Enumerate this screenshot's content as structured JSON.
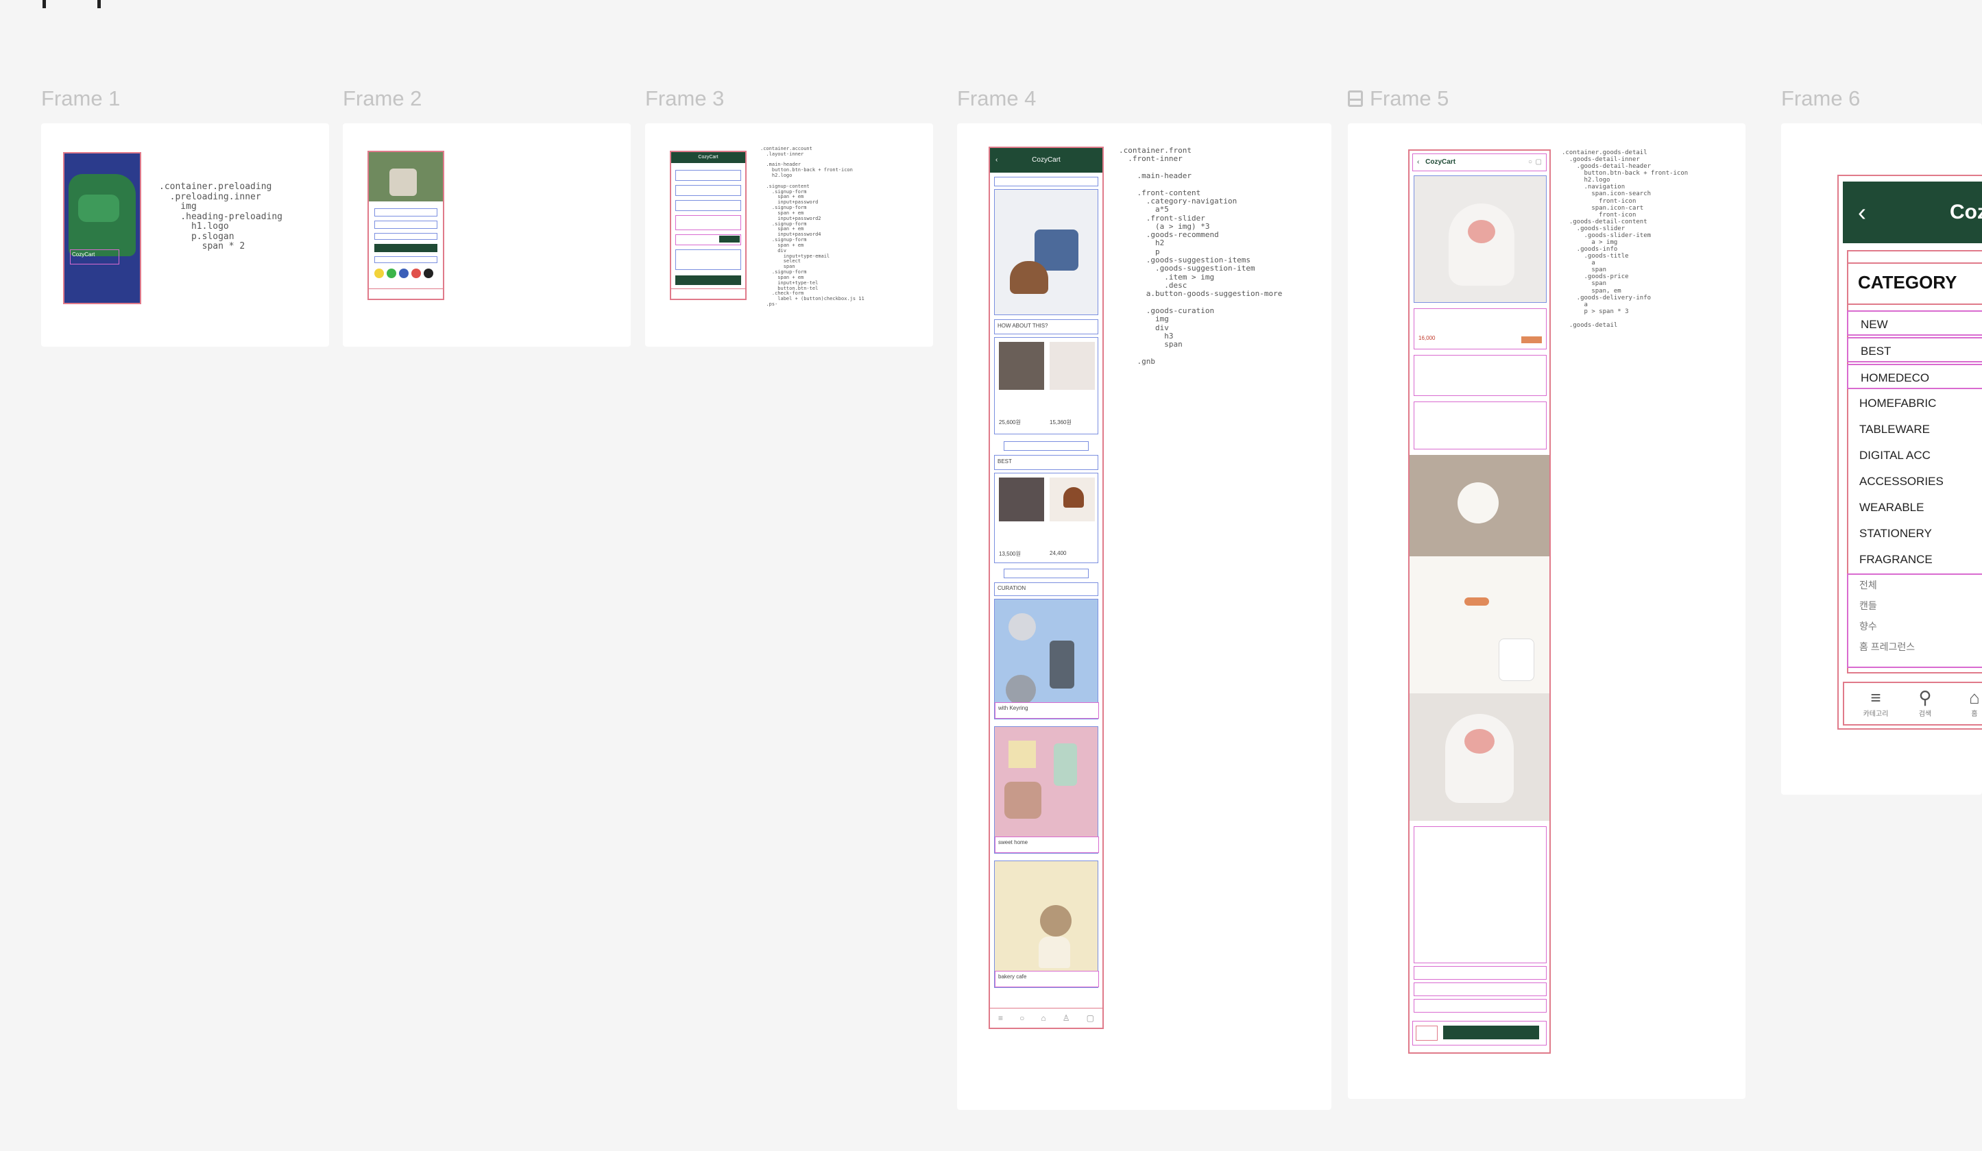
{
  "frames": [
    {
      "label": "Frame 1"
    },
    {
      "label": "Frame 2"
    },
    {
      "label": "Frame 3"
    },
    {
      "label": "Frame 4"
    },
    {
      "label": "Frame 5"
    },
    {
      "label": "Frame 6"
    }
  ],
  "frame1": {
    "code": ".container.preloading\n  .preloading.inner\n    img\n    .heading-preloading\n      h1.logo\n      p.slogan\n        span * 2",
    "brand": "CozyCart"
  },
  "frame3": {
    "header": "CozyCart",
    "code": ".container.account\n  .layout-inner\n\n  .main-header\n    button.btn-back + front-icon\n    h2.logo\n\n  .signup-content\n    .signup-form\n      span + em\n      input+password\n    .signup-form\n      span + em\n      input+password2\n    .signup-form\n      span + em\n      input+password4\n    .signup-form\n      span + em\n      div\n        input+type-email\n        select\n        span\n    .signup-form\n      span + em\n      input+type-tel\n      button.btn-tel\n    .check-form\n      label + (button)checkbox.js 11\n  .ps-"
  },
  "frame4": {
    "header": "CozyCart",
    "section_how": "HOW ABOUT THIS?",
    "section_best": "BEST",
    "section_curation": "CURATION",
    "card1": "with Keyring",
    "card2": "sweet home",
    "card3": "bakery cafe",
    "price1": "25,600원",
    "price2": "15,360원",
    "price3": "13,500원",
    "price4": "24,400",
    "code": ".container.front\n  .front-inner\n\n    .main-header\n\n    .front-content\n      .category-navigation\n        a*5\n      .front-slider\n        (a > img) *3\n      .goods-recommend\n        h2\n        p\n      .goods-suggestion-items\n        .goods-suggestion-item\n          .item > img\n          .desc\n      a.button-goods-suggestion-more\n\n      .goods-curation\n        img\n        div\n          h3\n          span\n\n    .gnb"
  },
  "frame5": {
    "header": "CozyCart",
    "price": "16,000",
    "code": ".container.goods-detail\n  .goods-detail-inner\n    .goods-detail-header\n      button.btn-back + front-icon\n      h2.logo\n      .navigation\n        span.icon-search\n          front-icon\n        span.icon-cart\n          front-icon\n  .goods-detail-content\n    .goods-slider\n      .goods-slider-item\n        a > img\n    .goods-info\n      .goods-title\n        a\n        span\n      .goods-price\n        span\n        span, em\n    .goods-delivery-info\n      a\n      p > span * 3\n\n  .goods-detail"
  },
  "frame6": {
    "brand": "Cozy",
    "category_title": "CATEGORY",
    "categories": [
      "NEW",
      "BEST",
      "HOMEDECO",
      "HOMEFABRIC",
      "TABLEWARE",
      "DIGITAL ACC",
      "ACCESSORIES",
      "WEARABLE",
      "STATIONERY",
      "FRAGRANCE"
    ],
    "korean": [
      "전체",
      "캔들",
      "향수",
      "홈 프레그런스"
    ],
    "nav": [
      "카테고리",
      "검색",
      "홈"
    ]
  },
  "colors": {
    "accent_green": "#1f4a35",
    "guide_pink": "#e07a8a",
    "guide_magenta": "#d96bd0",
    "guide_blue": "#7b8fe0"
  }
}
